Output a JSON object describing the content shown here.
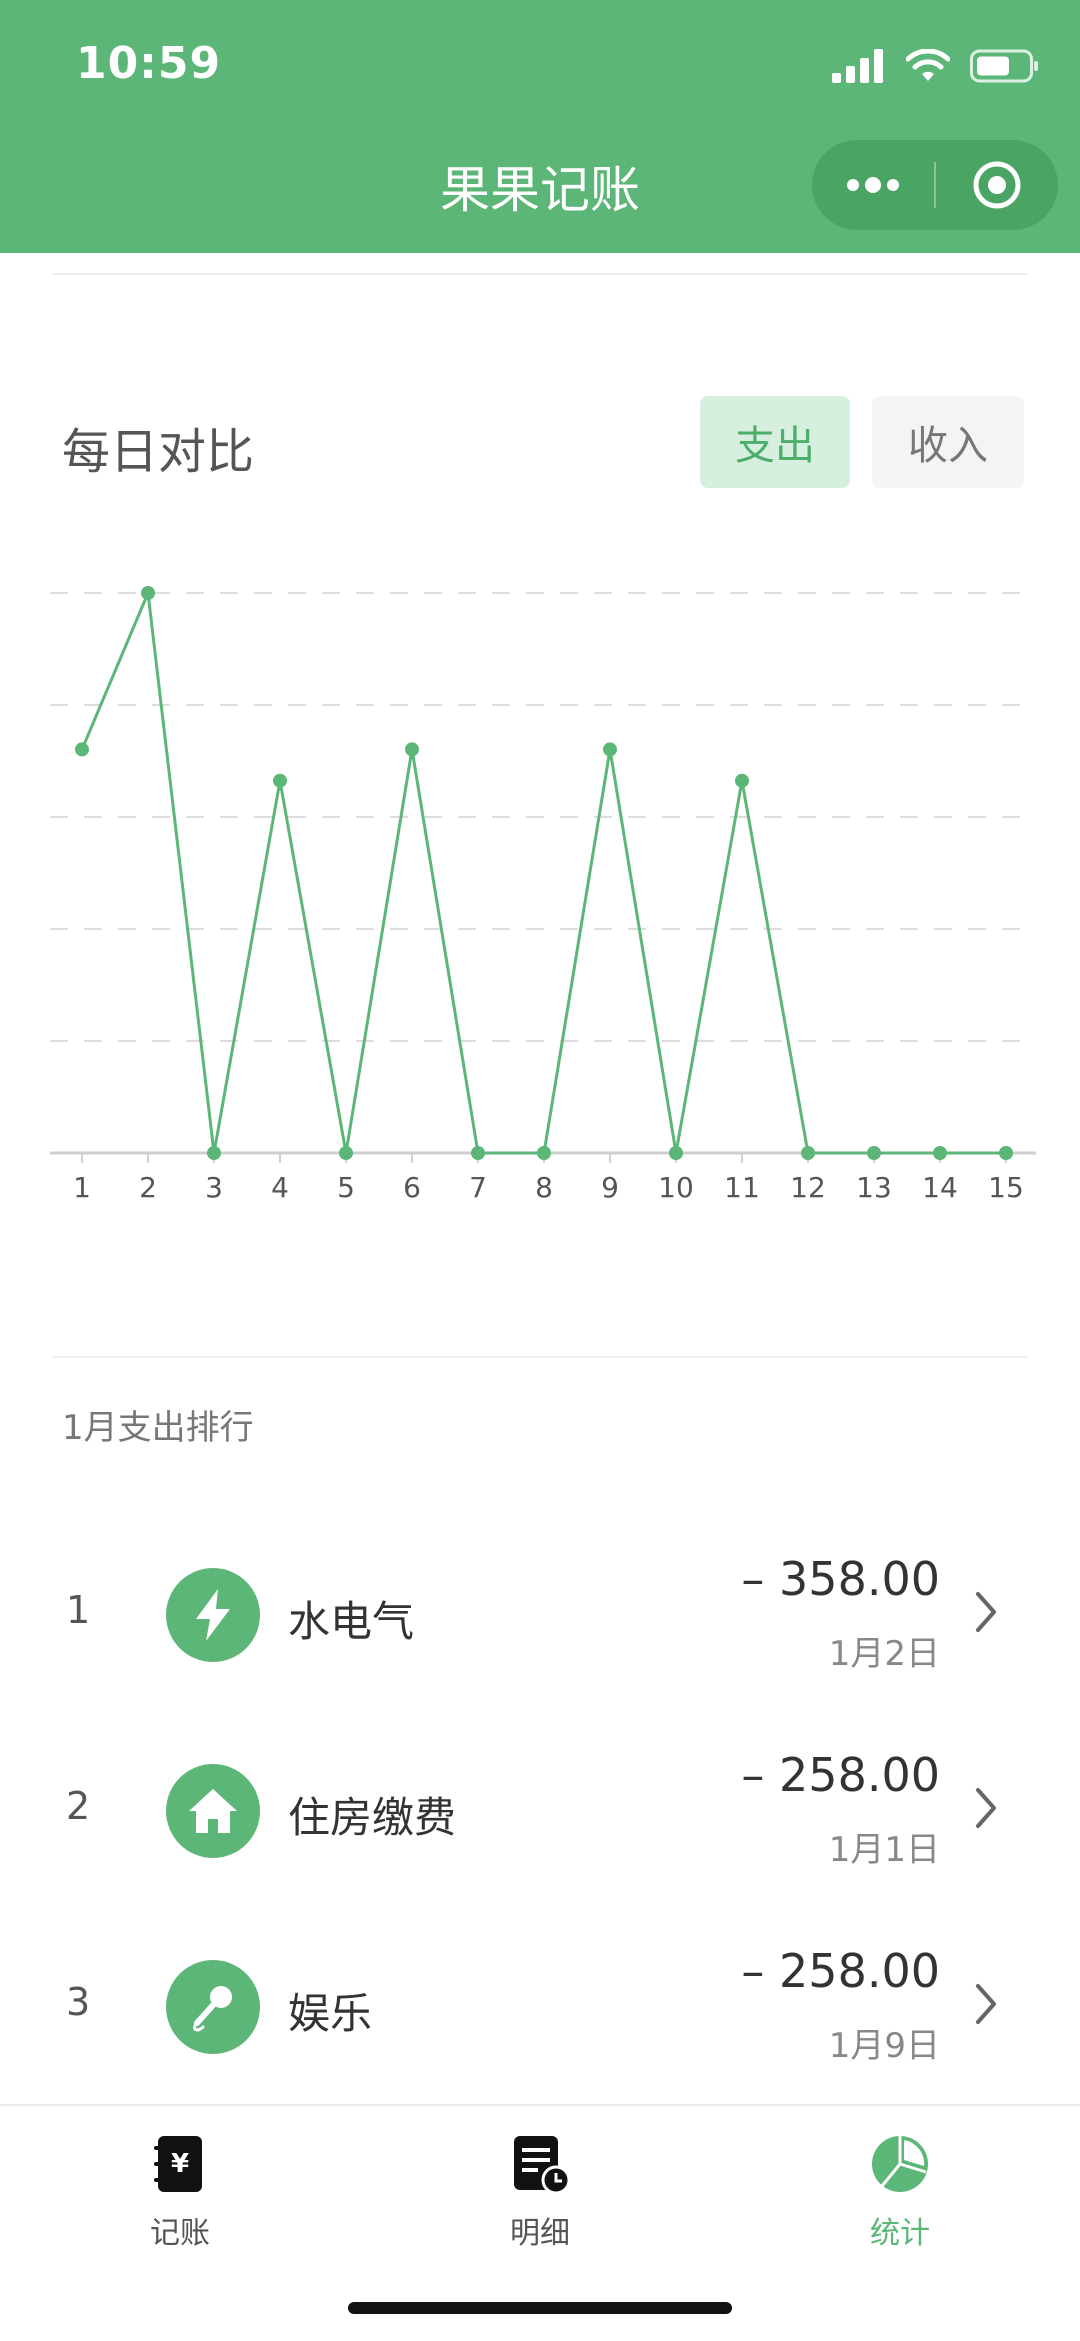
{
  "status_bar": {
    "time": "10:59"
  },
  "nav": {
    "title": "果果记账"
  },
  "daily": {
    "title": "每日对比",
    "segments": {
      "expense": "支出",
      "income": "收入"
    }
  },
  "chart_data": {
    "type": "line",
    "x": [
      1,
      2,
      3,
      4,
      5,
      6,
      7,
      8,
      9,
      10,
      11,
      12,
      13,
      14,
      15
    ],
    "values": [
      258,
      358,
      0,
      238,
      0,
      258,
      0,
      0,
      258,
      0,
      238,
      0,
      0,
      0,
      0
    ],
    "ylim": [
      0,
      358
    ],
    "grid": true,
    "color": "#5cb677"
  },
  "ranking": {
    "title": "1月支出排行",
    "items": [
      {
        "rank": "1",
        "icon": "lightning-icon",
        "name": "水电气",
        "amount": "– 358.00",
        "date": "1月2日"
      },
      {
        "rank": "2",
        "icon": "house-icon",
        "name": "住房缴费",
        "amount": "– 258.00",
        "date": "1月1日"
      },
      {
        "rank": "3",
        "icon": "microphone-icon",
        "name": "娱乐",
        "amount": "– 258.00",
        "date": "1月9日"
      }
    ]
  },
  "tabbar": {
    "items": [
      {
        "label": "记账",
        "icon": "ledger-icon",
        "active": false
      },
      {
        "label": "明细",
        "icon": "detail-icon",
        "active": false
      },
      {
        "label": "统计",
        "icon": "piechart-icon",
        "active": true
      }
    ]
  },
  "colors": {
    "brand": "#5cb677",
    "accent_bg": "#d6efdf"
  }
}
